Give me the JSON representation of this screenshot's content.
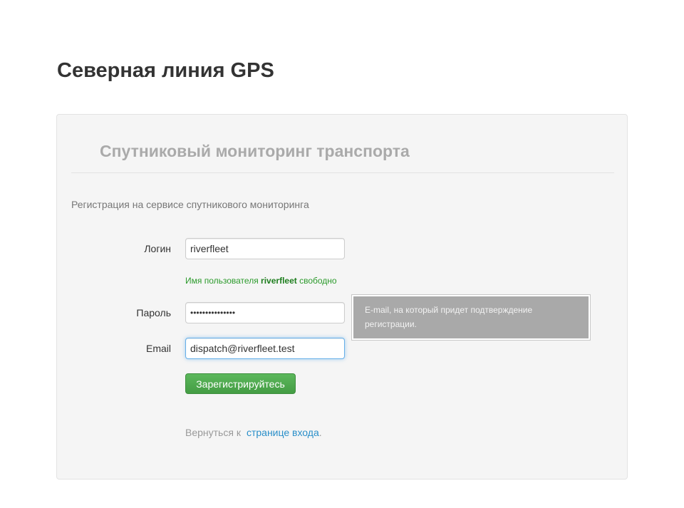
{
  "site": {
    "title": "Северная линия GPS"
  },
  "panel": {
    "heading": "Спутниковый мониторинг транспорта",
    "intro": "Регистрация на сервисе спутникового мониторинга"
  },
  "form": {
    "login_label": "Логин",
    "login_value": "riverfleet",
    "login_help_prefix": "Имя пользователя",
    "login_help_username": "riverfleet",
    "login_help_suffix": "свободно",
    "password_label": "Пароль",
    "password_value": "•••••••••••••••",
    "email_label": "Email",
    "email_value": "dispatch@riverfleet.test",
    "email_tooltip": "E-mail, на который придет подтверждение регистрации.",
    "submit_label": "Зарегистрируйтесь"
  },
  "footer": {
    "back_text": "Вернуться к",
    "back_link": "странице входа",
    "back_period": "."
  },
  "colors": {
    "accent_green": "#5cb85c",
    "link_blue": "#2a8fc9",
    "focus_blue": "#66afe9",
    "help_green": "#2b9a2b"
  }
}
